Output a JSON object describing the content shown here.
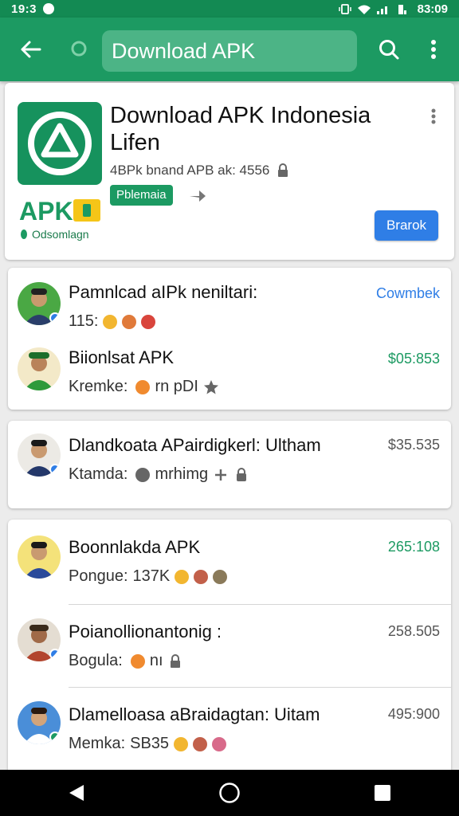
{
  "status_bar": {
    "time": "19:3",
    "clock": "83:09"
  },
  "app_bar": {
    "search_text": "Download APK"
  },
  "top_card": {
    "title": "Download APK Indonesia Lifen",
    "meta": "4BPk bnand APB ak: 4556",
    "tag": "Pblemaia",
    "logo_text": "APK",
    "developer": "Odsomlagn",
    "install_label": "Brarok"
  },
  "card_a": {
    "items": [
      {
        "title": "Pamnlcad aIPk neniltari:",
        "sub": "115:",
        "value": "Cowmbek",
        "value_color": "#2f7ee6"
      },
      {
        "title": "Biionlsat APK",
        "sub": "Kremke:",
        "sub_extra": "rn pDI",
        "value": "$05:853",
        "value_color": "#1c9a62"
      }
    ]
  },
  "card_b": {
    "items": [
      {
        "title": "Dlandkoata APairdigkerl: Ultham",
        "sub": "Ktamda:",
        "sub_extra": "mrhimg",
        "value": "$35.535",
        "value_color": "#555555"
      }
    ]
  },
  "card_c": {
    "items": [
      {
        "title": "Boonnlakda APK",
        "sub": "Pongue:",
        "sub_extra": "137K",
        "value": "265:108",
        "value_color": "#1c9a62"
      },
      {
        "title": "Poianollionantonig :",
        "sub": "Bogula:",
        "sub_extra": "nı",
        "value": "258.505",
        "value_color": "#555555"
      },
      {
        "title": "Dlamelloasa aBraidagtan: Uitam",
        "sub": "Memka:",
        "sub_extra": "SB35",
        "value": "495:900",
        "value_color": "#555555"
      }
    ]
  }
}
